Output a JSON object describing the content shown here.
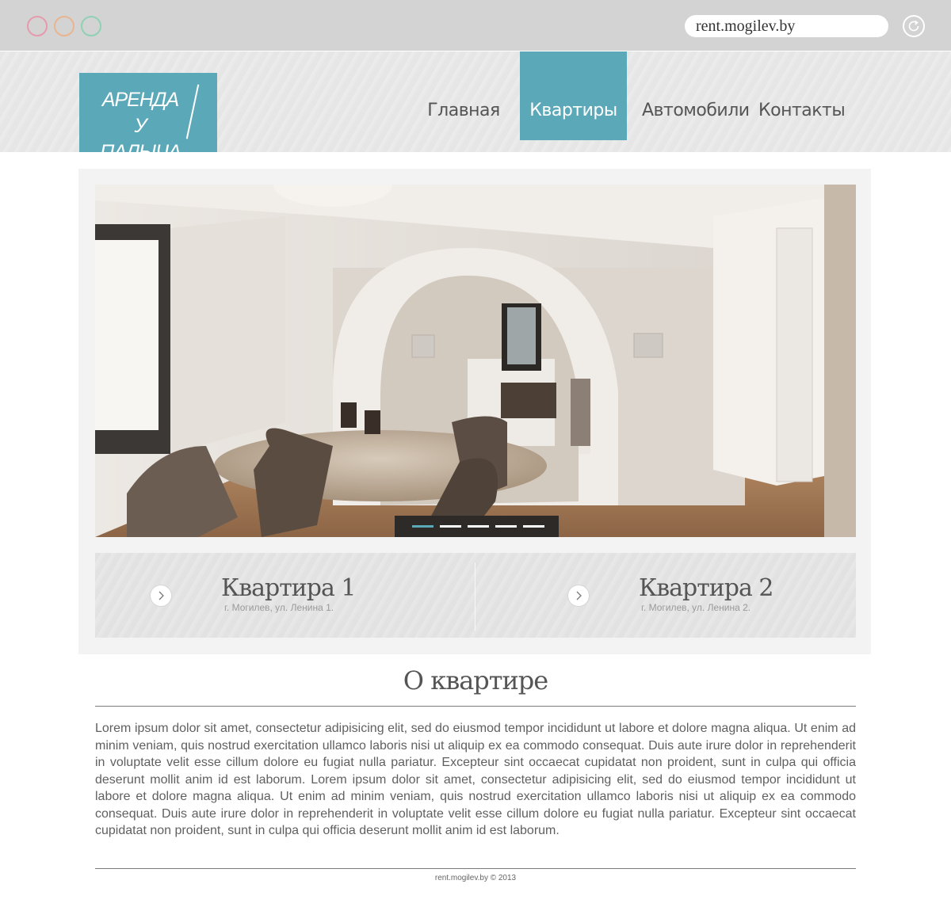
{
  "colors": {
    "accent": "#5ba8b8",
    "window_dots": [
      "#e69aae",
      "#e9b48f",
      "#8fd1b5"
    ]
  },
  "browser": {
    "url": "rent.mogilev.by",
    "reload_icon": "reload-icon",
    "window_dot_icons": [
      "close-dot-icon",
      "minimize-dot-icon",
      "maximize-dot-icon"
    ]
  },
  "header": {
    "logo_line1": "АРЕНДА",
    "logo_line2": "У ПАЛЫЧА",
    "nav": [
      "Главная",
      "Квартиры",
      "Автомобили",
      "Контакты"
    ],
    "active_nav": "Квартиры"
  },
  "slider": {
    "slide_count": 5,
    "active_slide": 1
  },
  "cards": [
    {
      "title": "Квартира 1",
      "address": "г. Могилев, ул. Ленина 1.",
      "icon": "chevron-right-icon"
    },
    {
      "title": "Квартира 2",
      "address": "г. Могилев, ул. Ленина 2.",
      "icon": "chevron-right-icon"
    }
  ],
  "about": {
    "title": "О квартире",
    "text": "Lorem ipsum dolor sit amet, consectetur adipisicing elit, sed do eiusmod tempor incididunt ut labore et dolore magna aliqua. Ut enim ad minim veniam, quis nostrud exercitation ullamco laboris nisi ut aliquip ex ea commodo consequat. Duis aute irure dolor in reprehenderit in voluptate velit esse cillum dolore eu fugiat nulla pariatur. Excepteur sint occaecat cupidatat non proident, sunt in culpa qui officia deserunt mollit anim id est laborum. Lorem ipsum dolor sit amet, consectetur adipisicing elit, sed do eiusmod tempor incididunt ut labore et dolore magna aliqua. Ut enim ad minim veniam, quis nostrud exercitation ullamco laboris nisi ut aliquip ex ea commodo consequat. Duis aute irure dolor in reprehenderit in voluptate velit esse cillum dolore eu fugiat nulla pariatur. Excepteur sint occaecat cupidatat non proident, sunt in culpa qui officia deserunt mollit anim id est laborum."
  },
  "footer": {
    "text": "rent.mogilev.by © 2013"
  }
}
